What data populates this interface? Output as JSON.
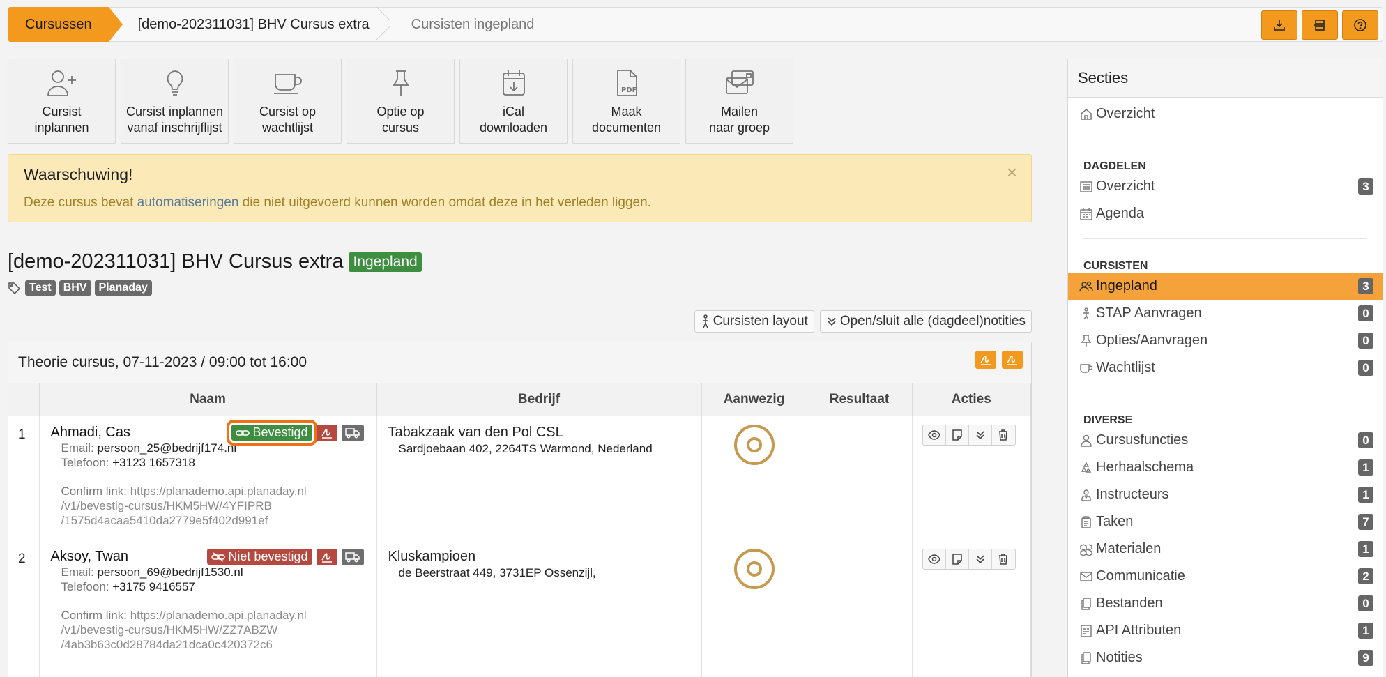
{
  "breadcrumb": {
    "root": "Cursussen",
    "course": "[demo-202311031] BHV Cursus extra",
    "current": "Cursisten ingepland"
  },
  "top_actions": [
    {
      "icon": "download-icon"
    },
    {
      "icon": "layout-icon"
    },
    {
      "icon": "help-icon"
    }
  ],
  "tiles": [
    {
      "icon": "user-plus-icon",
      "line1": "Cursist",
      "line2": "inplannen"
    },
    {
      "icon": "lightbulb-icon",
      "line1": "Cursist inplannen",
      "line2": "vanaf inschrijflijst"
    },
    {
      "icon": "coffee-cup-icon",
      "line1": "Cursist op",
      "line2": "wachtlijst"
    },
    {
      "icon": "pin-icon",
      "line1": "Optie op",
      "line2": "cursus"
    },
    {
      "icon": "calendar-download-icon",
      "line1": "iCal",
      "line2": "downloaden"
    },
    {
      "icon": "pdf-file-icon",
      "line1": "Maak",
      "line2": "documenten"
    },
    {
      "icon": "mail-group-icon",
      "line1": "Mailen",
      "line2": "naar groep"
    }
  ],
  "warning": {
    "title": "Waarschuwing!",
    "text_before": "Deze cursus bevat ",
    "link": "automatiseringen",
    "text_after": " die niet uitgevoerd kunnen worden omdat deze in het verleden liggen.",
    "close": "×"
  },
  "course": {
    "title": "[demo-202311031] BHV Cursus extra",
    "status": "Ingepland",
    "tags": [
      "Test",
      "BHV",
      "Planaday"
    ]
  },
  "buttons": {
    "layout": "Cursisten layout",
    "toggle_notes": "Open/sluit alle (dagdeel)notities"
  },
  "session": {
    "title": "Theorie cursus, 07-11-2023 / 09:00 tot 16:00",
    "columns": [
      "Naam",
      "Bedrijf",
      "Aanwezig",
      "Resultaat",
      "Acties"
    ]
  },
  "students": [
    {
      "num": "1",
      "name": "Ahmadi, Cas",
      "status": "Bevestigd",
      "email_label": "Email:",
      "email": "persoon_25@bedrijf174.nl",
      "phone_label": "Telefoon:",
      "phone": "+3123 1657318",
      "confirm_label": "Confirm link:",
      "link1": "https://planademo.api.planaday.nl",
      "link2": "/v1/bevestig-cursus/HKM5HW/4YFIPRB",
      "link3": "/1575d4acaa5410da2779e5f402d991ef",
      "company": "Tabakzaak van den Pol CSL",
      "address": "Sardjoebaan 402, 2264TS Warmond, Nederland"
    },
    {
      "num": "2",
      "name": "Aksoy, Twan",
      "status": "Niet bevestigd",
      "email_label": "Email:",
      "email": "persoon_69@bedrijf1530.nl",
      "phone_label": "Telefoon:",
      "phone": "+3175 9416557",
      "confirm_label": "Confirm link:",
      "link1": "https://planademo.api.planaday.nl",
      "link2": "/v1/bevestig-cursus/HKM5HW/ZZ7ABZW",
      "link3": "/4ab3b63c0d28784da21dca0c420372c6",
      "company": "Kluskampioen",
      "address": "de Beerstraat 449, 3731EP Ossenzijl,"
    }
  ],
  "sidebar": {
    "title": "Secties",
    "overview": "Overzicht",
    "dagdelen": {
      "heading": "DAGDELEN",
      "items": [
        {
          "label": "Overzicht",
          "count": "3",
          "icon": "list-icon"
        },
        {
          "label": "Agenda",
          "count": "",
          "icon": "calendar-icon"
        }
      ]
    },
    "cursisten": {
      "heading": "CURSISTEN",
      "items": [
        {
          "label": "Ingepland",
          "count": "3",
          "icon": "users-icon"
        },
        {
          "label": "STAP Aanvragen",
          "count": "0",
          "icon": "walk-icon"
        },
        {
          "label": "Opties/Aanvragen",
          "count": "0",
          "icon": "pin-icon"
        },
        {
          "label": "Wachtlijst",
          "count": "0",
          "icon": "coffee-cup-icon"
        }
      ]
    },
    "diverse": {
      "heading": "DIVERSE",
      "items": [
        {
          "label": "Cursusfuncties",
          "count": "0",
          "icon": "user-role-icon"
        },
        {
          "label": "Herhaalschema",
          "count": "1",
          "icon": "recycle-icon"
        },
        {
          "label": "Instructeurs",
          "count": "1",
          "icon": "instructor-icon"
        },
        {
          "label": "Taken",
          "count": "7",
          "icon": "clipboard-icon"
        },
        {
          "label": "Materialen",
          "count": "1",
          "icon": "boxes-icon"
        },
        {
          "label": "Communicatie",
          "count": "2",
          "icon": "envelope-icon"
        },
        {
          "label": "Bestanden",
          "count": "0",
          "icon": "files-icon"
        },
        {
          "label": "API Attributen",
          "count": "1",
          "icon": "api-icon"
        },
        {
          "label": "Notities",
          "count": "9",
          "icon": "notes-icon"
        }
      ]
    }
  }
}
